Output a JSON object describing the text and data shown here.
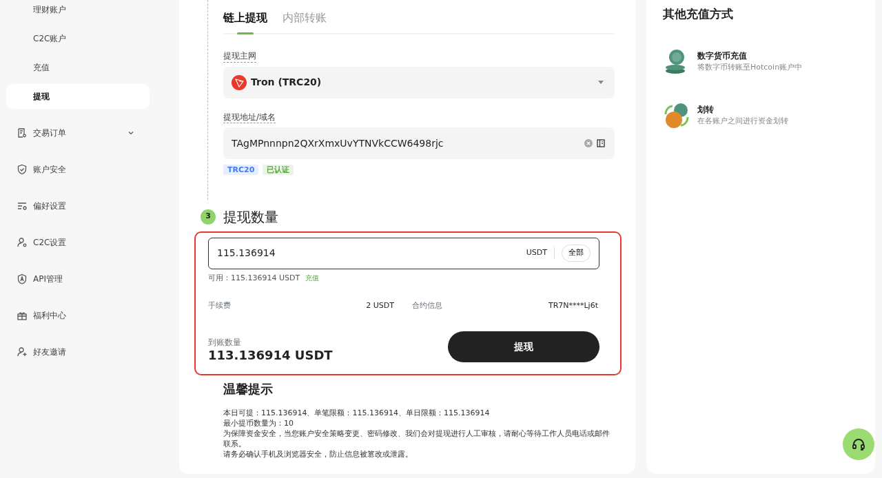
{
  "sidebar": {
    "items": [
      {
        "label": "理财账户",
        "kind": "sub",
        "selected": false
      },
      {
        "label": "C2C账户",
        "kind": "sub",
        "selected": false
      },
      {
        "label": "充值",
        "kind": "sub",
        "selected": false
      },
      {
        "label": "提现",
        "kind": "sub",
        "selected": true
      },
      {
        "label": "交易订单",
        "kind": "main",
        "selected": false,
        "expanded": false
      },
      {
        "label": "账户安全",
        "kind": "main",
        "selected": false
      },
      {
        "label": "偏好设置",
        "kind": "main",
        "selected": false
      },
      {
        "label": "C2C设置",
        "kind": "main",
        "selected": false
      },
      {
        "label": "API管理",
        "kind": "main",
        "selected": false
      },
      {
        "label": "福利中心",
        "kind": "main",
        "selected": false
      },
      {
        "label": "好友邀请",
        "kind": "main",
        "selected": false
      }
    ]
  },
  "tabs": [
    {
      "label": "链上提现",
      "selected": true
    },
    {
      "label": "内部转账",
      "selected": false
    }
  ],
  "network": {
    "label": "提现主网",
    "value": "Tron (TRC20)"
  },
  "address": {
    "label": "提现地址/域名",
    "value": "TAgMPnnnpn2QXrXmxUvYTNVkCCW6498rjc",
    "tags": [
      {
        "label": "TRC20",
        "color": "#3d7bf7"
      },
      {
        "label": "已认证",
        "color": "#55a83a"
      }
    ]
  },
  "amount": {
    "step": "3",
    "title": "提现数量",
    "value": "115.136914",
    "unit": "USDT",
    "all_button": "全部",
    "available_label": "可用：",
    "available": "115.136914 USDT",
    "deposit_link": "充值",
    "fee_label": "手续费",
    "fee": "2 USDT",
    "contract_label": "合约信息",
    "contract": "TR7N****Lj6t",
    "receive_label": "到账数量",
    "receive": "113.136914 USDT",
    "submit": "提现"
  },
  "tips": {
    "title": "温馨提示",
    "lines": [
      "本日可提：115.136914、单笔限额：115.136914、单日限额：115.136914",
      "最小提币数量为：10",
      "为保障资金安全，当您账户安全策略变更、密码修改、我们会对提现进行人工审核，请耐心等待工作人员电话或邮件联系。",
      "请务必确认手机及浏览器安全，防止信息被篡改或泄露。"
    ]
  },
  "other": {
    "title": "其他充值方式",
    "methods": [
      {
        "title": "数字货币充值",
        "desc": "将数字币转账至Hotcoin账户中"
      },
      {
        "title": "划转",
        "desc": "在各账户之间进行资金划转"
      }
    ]
  }
}
